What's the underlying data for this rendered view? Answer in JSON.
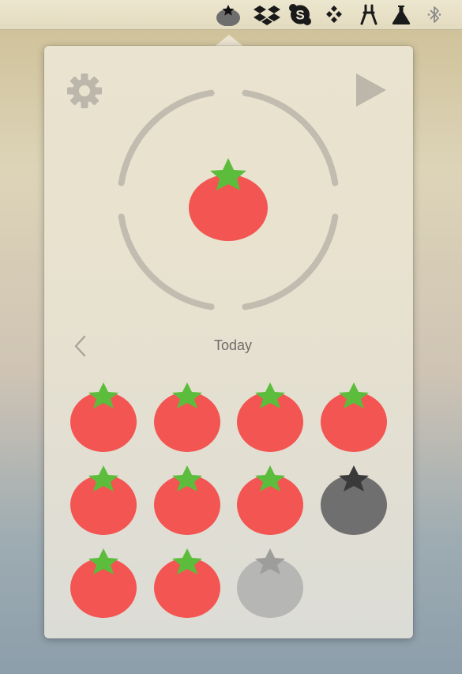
{
  "menubar": {
    "icons": [
      {
        "name": "pomodoro-tomato-icon",
        "active": true
      },
      {
        "name": "dropbox-icon"
      },
      {
        "name": "skype-icon"
      },
      {
        "name": "box-dots-icon"
      },
      {
        "name": "clamp-tool-icon"
      },
      {
        "name": "flask-icon"
      },
      {
        "name": "bluetooth-icon"
      }
    ]
  },
  "popover": {
    "settings_icon": "gear-icon",
    "play_icon": "play-icon",
    "timer": {
      "segments": 4,
      "center_icon": "tomato-icon"
    },
    "history": {
      "nav_prev_icon": "chevron-left-icon",
      "day_label": "Today",
      "sessions": [
        "completed",
        "completed",
        "completed",
        "completed",
        "completed",
        "completed",
        "completed",
        "interrupted",
        "completed",
        "completed",
        "pending"
      ]
    }
  },
  "colors": {
    "tomato_red": "#f35552",
    "leaf_green": "#5cbd3c",
    "interrupted_gray": "#6f6f6f",
    "pending_gray": "#b6b6b4",
    "ring_gray": "#c2bcb0",
    "icon_gray": "#bcb6ab"
  }
}
